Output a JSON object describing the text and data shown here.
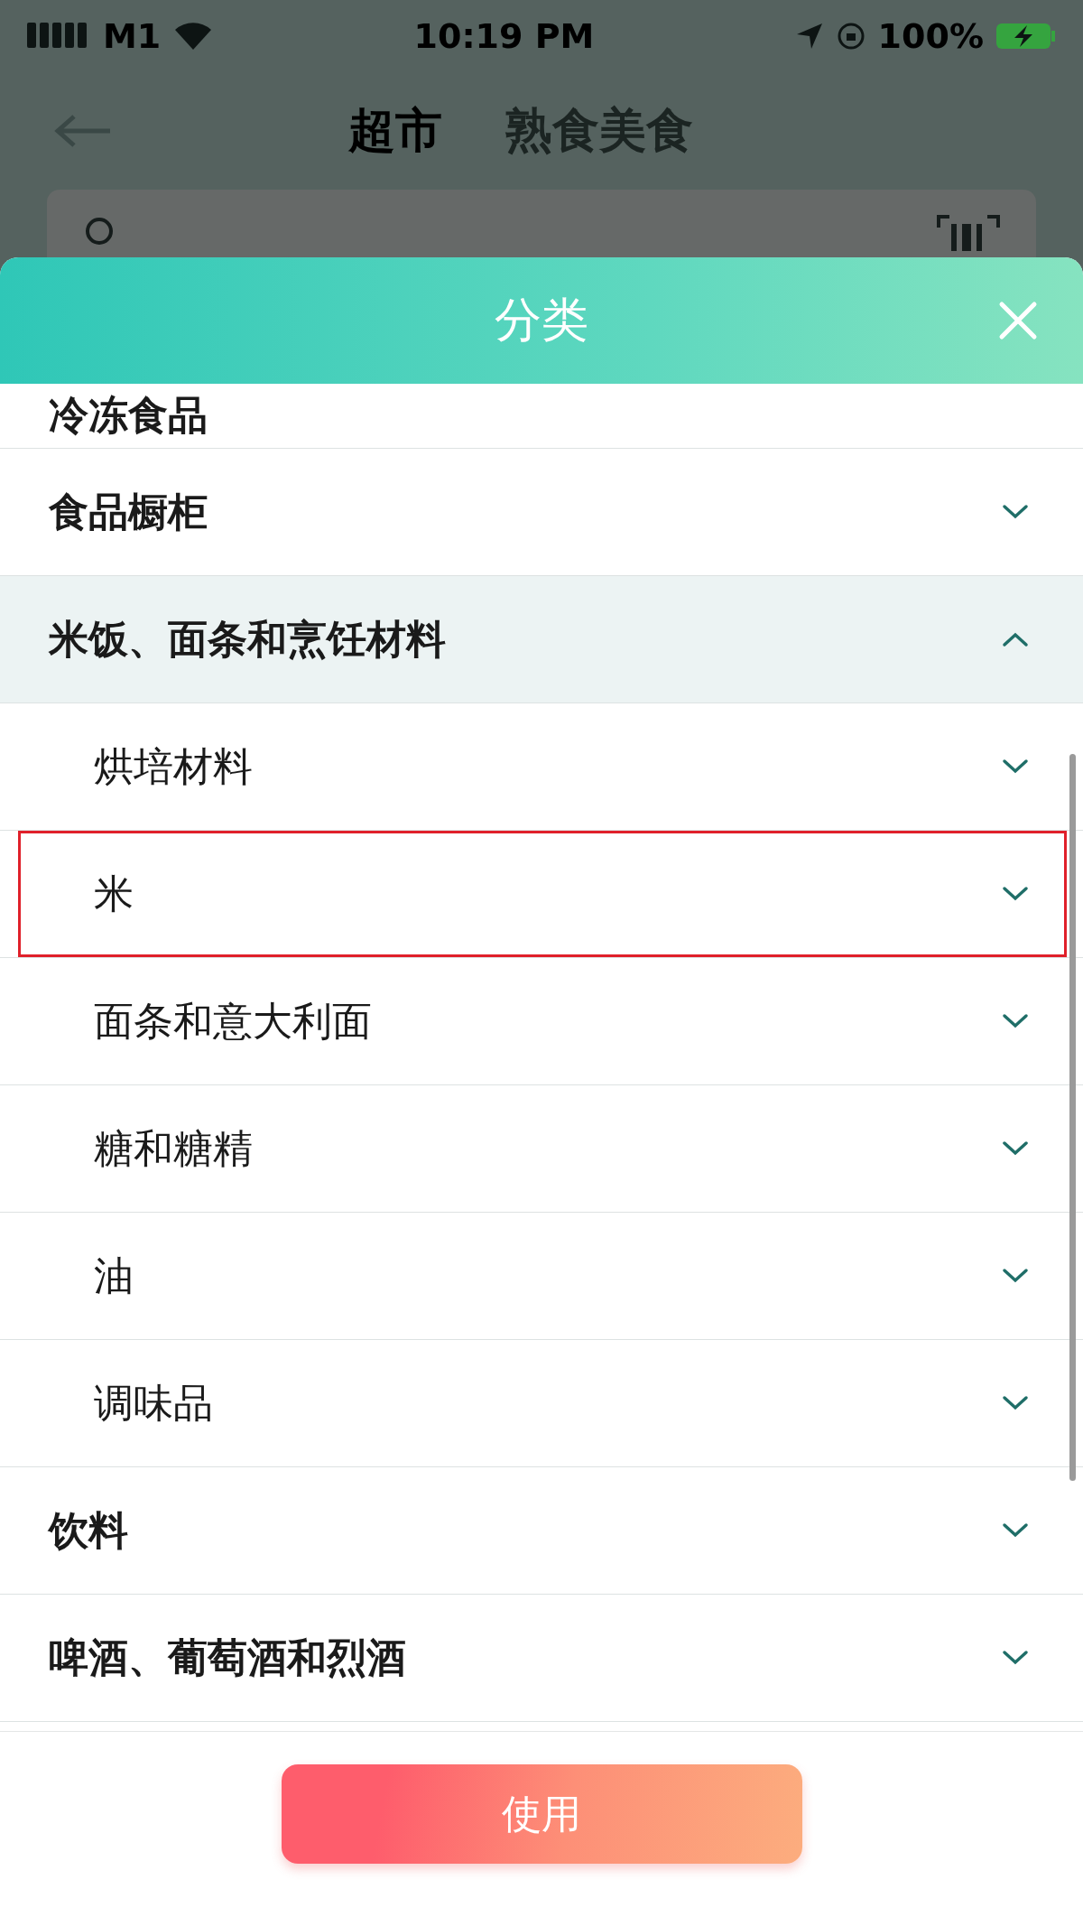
{
  "status_bar": {
    "carrier": "M1",
    "time": "10:19 PM",
    "battery": "100%"
  },
  "nav": {
    "tabs": [
      {
        "label": "超市",
        "selected": true
      },
      {
        "label": "熟食美食",
        "selected": false
      }
    ]
  },
  "sheet": {
    "title": "分类",
    "categories": [
      {
        "label": "冷冻食品",
        "selected": false
      },
      {
        "label": "食品橱柜",
        "expanded": false,
        "selected": false
      },
      {
        "label": "米饭、面条和烹饪材料",
        "expanded": true,
        "selected": false,
        "children": [
          {
            "label": "烘培材料",
            "expanded": false,
            "selected": false
          },
          {
            "label": "米",
            "expanded": false,
            "selected": true
          },
          {
            "label": "面条和意大利面",
            "expanded": false,
            "selected": false
          },
          {
            "label": "糖和糖精",
            "expanded": false,
            "selected": false
          },
          {
            "label": "油",
            "expanded": false,
            "selected": false
          },
          {
            "label": "调味品",
            "expanded": false,
            "selected": false
          }
        ]
      },
      {
        "label": "饮料",
        "expanded": false,
        "selected": false
      },
      {
        "label": "啤酒、葡萄酒和烈酒",
        "expanded": false,
        "selected": false
      }
    ],
    "apply_button": "使用"
  }
}
